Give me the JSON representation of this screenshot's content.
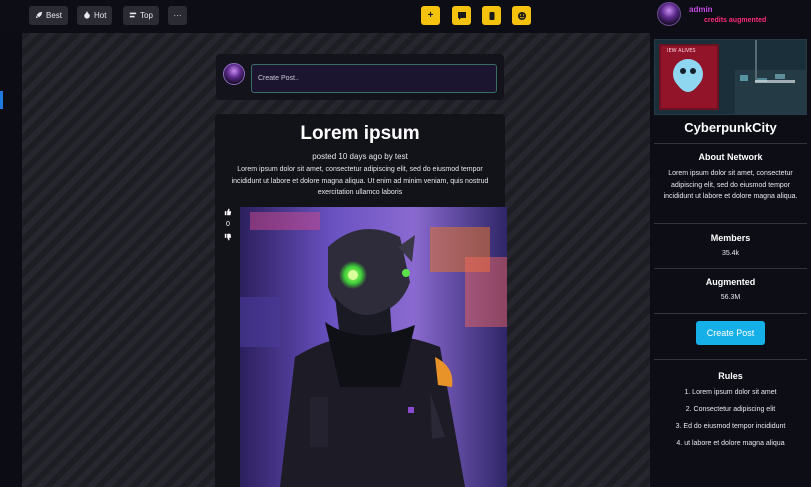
{
  "topbar": {
    "sort": [
      {
        "label": "Best",
        "icon": "rocket-icon",
        "glyph": "🚀"
      },
      {
        "label": "Hot",
        "icon": "fire-icon",
        "glyph": "🔥"
      },
      {
        "label": "Top",
        "icon": "ranking-icon",
        "glyph": "⇅"
      }
    ],
    "more_label": "···",
    "actions": [
      {
        "icon": "plus-icon",
        "glyph": "+"
      },
      {
        "icon": "message-icon",
        "glyph": "▬"
      },
      {
        "icon": "trash-icon",
        "glyph": "▮"
      },
      {
        "icon": "smile-icon",
        "glyph": "☻"
      }
    ],
    "user": {
      "name": "admin",
      "credits": "credits augmented"
    },
    "accent_yellow": "#f5c20d"
  },
  "composer": {
    "placeholder": "Create Post.."
  },
  "post": {
    "title": "Lorem ipsum",
    "meta": "posted 10 days ago by test",
    "body": "Lorem ipsum dolor sit amet, consectetur adipiscing elit, sed do eiusmod tempor incididunt ut labore et dolore magna aliqua. Ut enim ad minim veniam, quis nostrud exercitation ullamco laboris",
    "votes": 0
  },
  "sidebar": {
    "community_name": "CyberpunkCity",
    "banner_sign": "IEW ALIVES",
    "about_title": "About Network",
    "about_text": "Lorem ipsum dolor sit amet, consectetur adipiscing elit, sed do eiusmod tempor incididunt ut labore et dolore magna aliqua.",
    "members_title": "Members",
    "members_value": "35.4k",
    "augmented_title": "Augmented",
    "augmented_value": "56.3M",
    "create_post_label": "Create Post",
    "accent_blue": "#15b0e8",
    "rules_title": "Rules",
    "rules": [
      "1. Lorem ipsum dolor sit amet",
      "2. Consectetur adipiscing elit",
      "3. Ed do eiusmod tempor incididunt",
      "4. ut labore et dolore magna aliqua"
    ]
  }
}
